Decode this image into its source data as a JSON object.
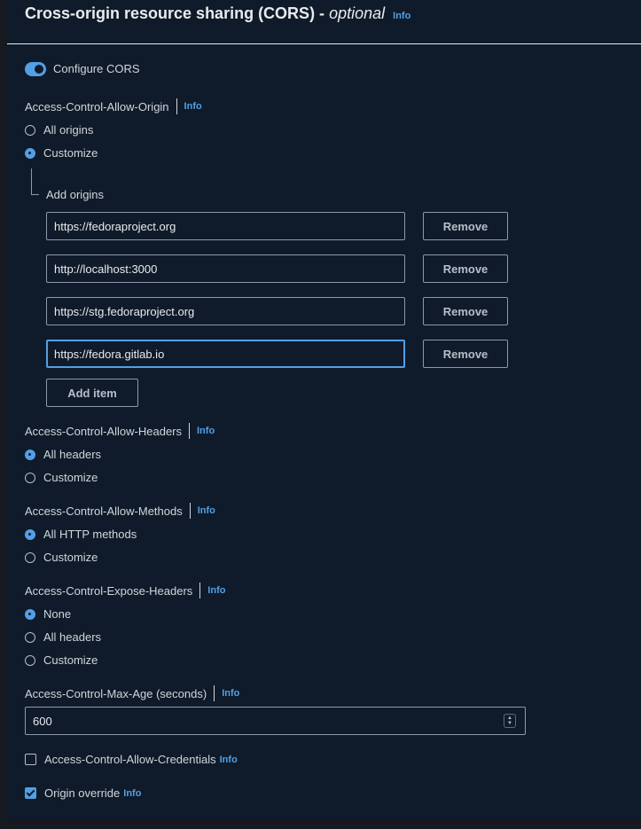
{
  "header": {
    "title": "Cross-origin resource sharing (CORS) -",
    "optional": "optional",
    "info": "Info"
  },
  "configure_cors": {
    "label": "Configure CORS",
    "enabled": true
  },
  "allow_origin": {
    "label": "Access-Control-Allow-Origin",
    "info": "Info",
    "options": [
      "All origins",
      "Customize"
    ],
    "selected": "Customize",
    "add_origins_label": "Add origins",
    "origins": [
      "https://fedoraproject.org",
      "http://localhost:3000",
      "https://stg.fedoraproject.org",
      "https://fedora.gitlab.io"
    ],
    "remove_label": "Remove",
    "add_item_label": "Add item"
  },
  "allow_headers": {
    "label": "Access-Control-Allow-Headers",
    "info": "Info",
    "options": [
      "All headers",
      "Customize"
    ],
    "selected": "All headers"
  },
  "allow_methods": {
    "label": "Access-Control-Allow-Methods",
    "info": "Info",
    "options": [
      "All HTTP methods",
      "Customize"
    ],
    "selected": "All HTTP methods"
  },
  "expose_headers": {
    "label": "Access-Control-Expose-Headers",
    "info": "Info",
    "options": [
      "None",
      "All headers",
      "Customize"
    ],
    "selected": "None"
  },
  "max_age": {
    "label": "Access-Control-Max-Age (seconds)",
    "info": "Info",
    "value": "600"
  },
  "allow_credentials": {
    "label": "Access-Control-Allow-Credentials",
    "info": "Info",
    "checked": false
  },
  "origin_override": {
    "label": "Origin override",
    "info": "Info",
    "checked": true
  },
  "colors": {
    "accent": "#539fe5",
    "background": "#0f1b2a",
    "text": "#d1d5db"
  }
}
